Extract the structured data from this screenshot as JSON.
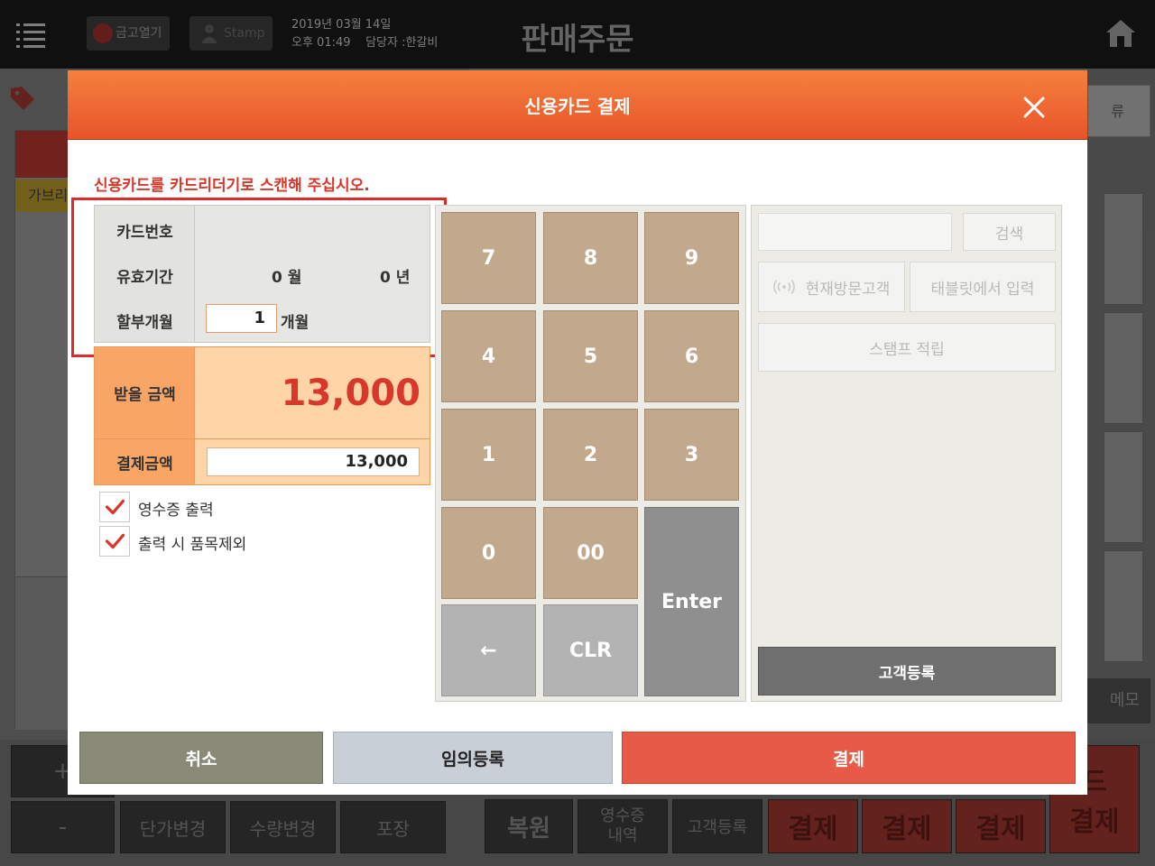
{
  "background": {
    "safe_button": "금고열기",
    "stamp_button": "Stamp",
    "date": "2019년 03월 14일",
    "time": "오후 01:49",
    "staff": "담당자 :한갈비",
    "page_title": "판매주문",
    "category_label": "가브리",
    "right_top_button": "류",
    "memo_button": "메모",
    "bottom_buttons": {
      "plus": "+",
      "minus": "-",
      "price_change": "단가변경",
      "qty_change": "수량변경",
      "packing": "포장",
      "restore": "복원",
      "receipt_history": "영수증\n내역",
      "customer_register": "고객등록",
      "pay": "결제",
      "card_pay_top": "드",
      "card_pay_bottom": "결제"
    }
  },
  "dialog": {
    "title": "신용카드 결제",
    "instruction": "신용카드를 카드리더기로 스캔해 주십시오.",
    "card_number_label": "카드번호",
    "card_number_value": "",
    "expiry_label": "유효기간",
    "expiry_month": "0 월",
    "expiry_year": "0 년",
    "installment_label": "할부개월",
    "installment_value": "1",
    "installment_unit": "개월",
    "receive_amount_label": "받을 금액",
    "receive_amount": "13,000",
    "payment_amount_label": "결제금액",
    "payment_amount": "13,000",
    "checkbox_receipt": "영수증 출력",
    "checkbox_receipt_checked": true,
    "checkbox_exclude_items": "출력 시 품목제외",
    "checkbox_exclude_items_checked": true,
    "keypad": {
      "k7": "7",
      "k8": "8",
      "k9": "9",
      "k4": "4",
      "k5": "5",
      "k6": "6",
      "k1": "1",
      "k2": "2",
      "k3": "3",
      "k0": "0",
      "k00": "00",
      "back": "←",
      "clr": "CLR",
      "enter": "Enter"
    },
    "customer": {
      "search_placeholder": "",
      "search_button": "검색",
      "current_visitor": "현재방문고객",
      "tablet_input": "태블릿에서 입력",
      "stamp_accumulate": "스탬프 적립",
      "register": "고객등록"
    },
    "footer": {
      "cancel": "취소",
      "temp_register": "임의등록",
      "pay": "결제"
    }
  },
  "colors": {
    "header_orange": "#f07035",
    "accent_red": "#e85a48",
    "keypad_tan": "#c2a88d",
    "alert_red": "#d8372a"
  }
}
